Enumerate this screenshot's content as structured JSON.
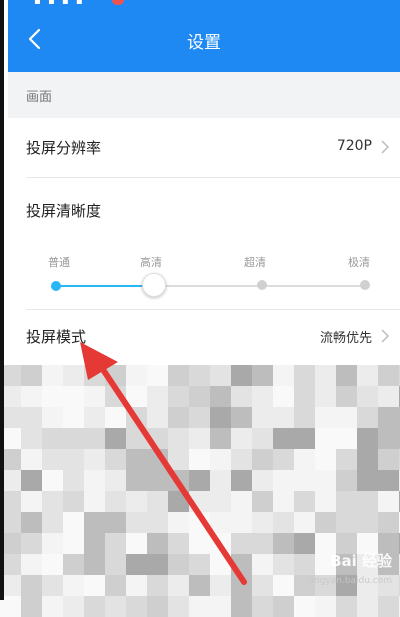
{
  "header": {
    "title": "设置"
  },
  "section": {
    "title": "画面"
  },
  "resolution": {
    "label": "投屏分辨率",
    "value": "720P"
  },
  "clarity": {
    "label": "投屏清晰度",
    "levels": [
      "普通",
      "高清",
      "超清",
      "极清"
    ],
    "selected": "高清",
    "selected_index": 1
  },
  "mode": {
    "label": "投屏模式",
    "value": "流畅优先"
  },
  "watermark": {
    "logo": "Bai 经验",
    "url": "jingyan.baidu.com"
  },
  "colors": {
    "brand": "#1e88f3",
    "accent": "#29b6f6",
    "annotation_arrow": "#e53935"
  }
}
